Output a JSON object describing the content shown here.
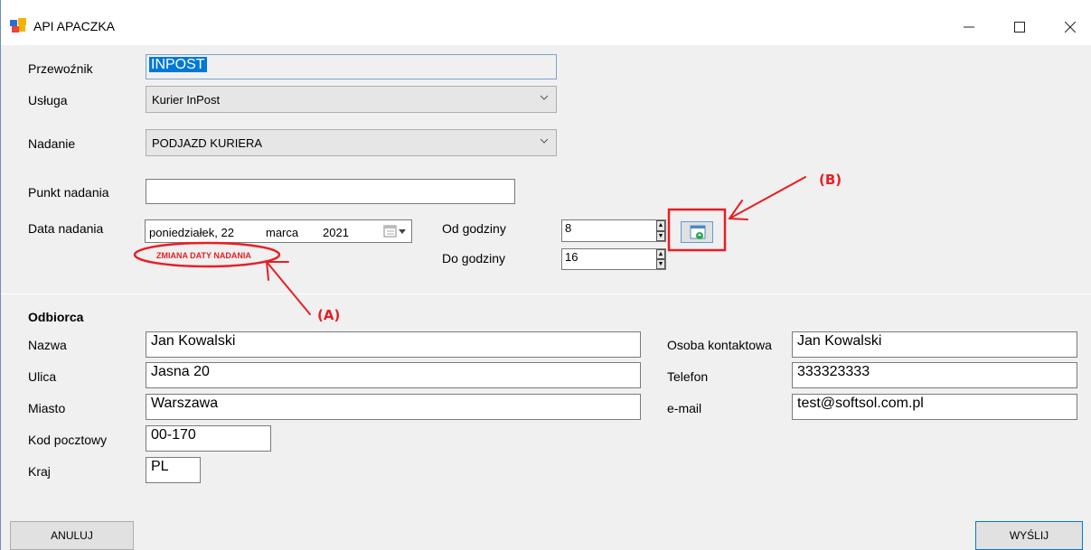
{
  "window": {
    "title": "API APACZKA"
  },
  "form": {
    "carrier_label": "Przewoźnik",
    "carrier_value": "INPOST",
    "service_label": "Usługa",
    "service_value": "Kurier InPost",
    "shipping_label": "Nadanie",
    "shipping_value": "PODJAZD KURIERA",
    "point_label": "Punkt nadania",
    "point_value": "",
    "date_label": "Data nadania",
    "date_day": "poniedziałek, 22",
    "date_month": "marca",
    "date_year": "2021",
    "from_label": "Od godziny",
    "from_value": "8",
    "to_label": "Do godziny",
    "to_value": "16"
  },
  "recipient": {
    "section_title": "Odbiorca",
    "name_label": "Nazwa",
    "name_value": "Jan Kowalski",
    "street_label": "Ulica",
    "street_value": "Jasna 20",
    "city_label": "Miasto",
    "city_value": "Warszawa",
    "postcode_label": "Kod pocztowy",
    "postcode_value": "00-170",
    "country_label": "Kraj",
    "country_value": "PL",
    "contact_label": "Osoba kontaktowa",
    "contact_value": "Jan Kowalski",
    "phone_label": "Telefon",
    "phone_value": "333323333",
    "email_label": "e-mail",
    "email_value": "test@softsol.com.pl"
  },
  "buttons": {
    "cancel": "ANULUJ",
    "send": "WYŚLIJ"
  },
  "annotations": {
    "a_label": "(A)",
    "b_label": "(B)",
    "date_change": "ZMIANA DATY NADANIA",
    "color": "#e81e25"
  },
  "icons": {
    "app": "app-icon",
    "refresh": "calendar-refresh-icon",
    "calendar": "calendar-dropdown-icon"
  },
  "colors": {
    "selection": "#0078d7",
    "background": "#f0f0f0"
  }
}
